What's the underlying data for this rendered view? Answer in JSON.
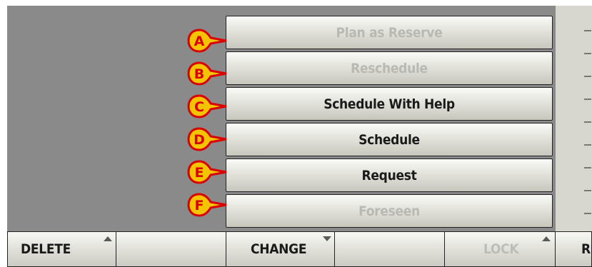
{
  "menu": {
    "items": [
      {
        "label": "Plan as Reserve",
        "marker": "A",
        "enabled": false
      },
      {
        "label": "Reschedule",
        "marker": "B",
        "enabled": false
      },
      {
        "label": "Schedule With Help",
        "marker": "C",
        "enabled": true
      },
      {
        "label": "Schedule",
        "marker": "D",
        "enabled": true
      },
      {
        "label": "Request",
        "marker": "E",
        "enabled": true
      },
      {
        "label": "Foreseen",
        "marker": "F",
        "enabled": false
      }
    ]
  },
  "toolbar": {
    "delete_label": "DELETE",
    "change_label": "CHANGE",
    "lock_label": "LOCK",
    "re_label": "RE"
  },
  "colors": {
    "panel_bg": "#8a8a8a",
    "marker_fill": "#f5c400",
    "marker_stroke": "#d90000"
  }
}
